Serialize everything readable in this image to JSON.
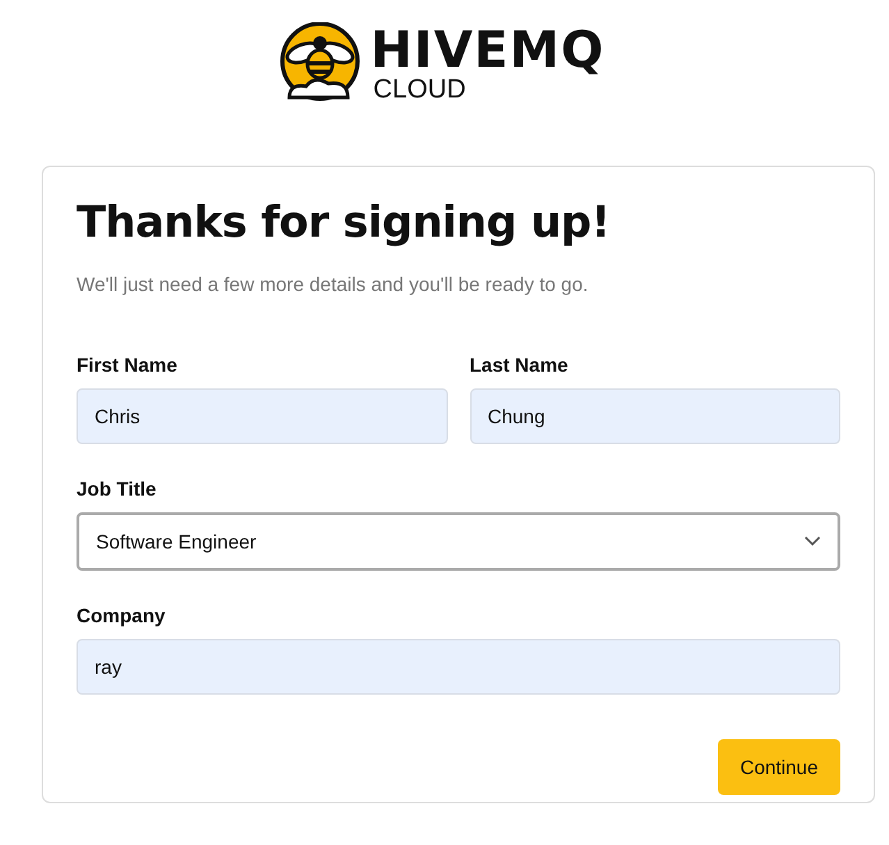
{
  "logo": {
    "name": "HIVEMQ",
    "subtitle": "CLOUD"
  },
  "form": {
    "title": "Thanks for signing up!",
    "subtitle": "We'll just need a few more details and you'll be ready to go.",
    "rows": [
      {
        "fields": [
          {
            "kind": "input",
            "label": "First Name",
            "value": "Chris"
          },
          {
            "kind": "input",
            "label": "Last Name",
            "value": "Chung"
          }
        ]
      },
      {
        "fields": [
          {
            "kind": "select",
            "label": "Job Title",
            "value": "Software Engineer"
          }
        ]
      },
      {
        "fields": [
          {
            "kind": "input",
            "label": "Company",
            "value": "ray"
          }
        ]
      }
    ],
    "button": "Continue"
  }
}
